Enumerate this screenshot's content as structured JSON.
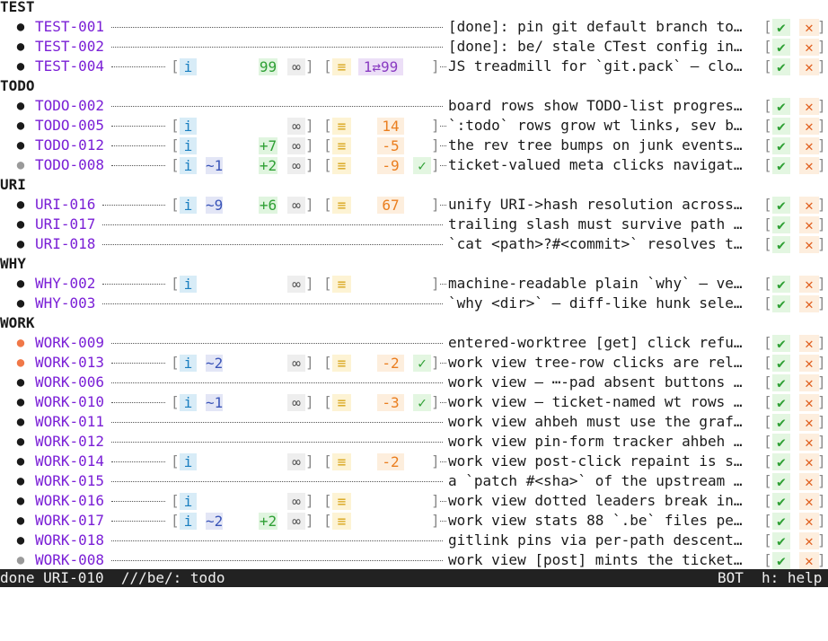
{
  "groups": [
    {
      "title": "TEST",
      "tickets": [
        {
          "id": "TEST-001",
          "dot": "black",
          "desc": "[done]: pin git default branch to…"
        },
        {
          "id": "TEST-002",
          "dot": "black",
          "desc": "[done]: be/ stale CTest config in…"
        },
        {
          "id": "TEST-004",
          "dot": "black",
          "info": "i",
          "plus": "99",
          "inf": "∞",
          "eq": "≡",
          "ahbeh": "1⇄99",
          "desc": "JS treadmill for `git.pack` – clo…"
        }
      ]
    },
    {
      "title": "TODO",
      "tickets": [
        {
          "id": "TODO-002",
          "dot": "black",
          "desc": "board rows show TODO-list progres…"
        },
        {
          "id": "TODO-005",
          "dot": "black",
          "info": "i",
          "inf": "∞",
          "eq": "≡",
          "num": "14",
          "desc": "`:todo` rows grow wt links, sev b…"
        },
        {
          "id": "TODO-012",
          "dot": "black",
          "info": "i",
          "plus": "+7",
          "inf": "∞",
          "eq": "≡",
          "num": "-5",
          "desc": "the rev tree bumps on junk events…"
        },
        {
          "id": "TODO-008",
          "dot": "gray",
          "info": "i",
          "wt": "~1",
          "plus": "+2",
          "inf": "∞",
          "eq": "≡",
          "num": "-9",
          "check": "✓",
          "desc": "ticket-valued meta clicks navigat…"
        }
      ]
    },
    {
      "title": "URI",
      "tickets": [
        {
          "id": "URI-016",
          "dot": "black",
          "info": "i",
          "wt": "~9",
          "plus": "+6",
          "inf": "∞",
          "eq": "≡",
          "num": "67",
          "desc": "unify URI->hash resolution across…"
        },
        {
          "id": "URI-017",
          "dot": "black",
          "desc": "trailing slash must survive path …"
        },
        {
          "id": "URI-018",
          "dot": "black",
          "desc": "`cat <path>?#<commit>` resolves t…"
        }
      ]
    },
    {
      "title": "WHY",
      "tickets": [
        {
          "id": "WHY-002",
          "dot": "black",
          "info": "i",
          "inf": "∞",
          "eq": "≡",
          "desc": "machine-readable plain `why` – ve…"
        },
        {
          "id": "WHY-003",
          "dot": "black",
          "desc": "`why <dir>` – diff-like hunk sele…"
        }
      ]
    },
    {
      "title": "WORK",
      "tickets": [
        {
          "id": "WORK-009",
          "dot": "orange",
          "desc": "entered-worktree [get] click refu…"
        },
        {
          "id": "WORK-013",
          "dot": "orange",
          "info": "i",
          "wt": "~2",
          "inf": "∞",
          "eq": "≡",
          "num": "-2",
          "check": "✓",
          "desc": "work view tree-row clicks are rel…"
        },
        {
          "id": "WORK-006",
          "dot": "black",
          "desc": "work view – ⋯-pad absent buttons …"
        },
        {
          "id": "WORK-010",
          "dot": "black",
          "info": "i",
          "wt": "~1",
          "inf": "∞",
          "eq": "≡",
          "num": "-3",
          "check": "✓",
          "desc": "work view – ticket-named wt rows …"
        },
        {
          "id": "WORK-011",
          "dot": "black",
          "desc": "work view ahbeh must use the graf…"
        },
        {
          "id": "WORK-012",
          "dot": "black",
          "desc": "work view pin-form tracker ahbeh …"
        },
        {
          "id": "WORK-014",
          "dot": "black",
          "info": "i",
          "inf": "∞",
          "eq": "≡",
          "num": "-2",
          "desc": "work view post-click repaint is s…"
        },
        {
          "id": "WORK-015",
          "dot": "black",
          "desc": "a `patch #<sha>` of the upstream …"
        },
        {
          "id": "WORK-016",
          "dot": "black",
          "info": "i",
          "inf": "∞",
          "eq": "≡",
          "desc": "work view dotted leaders break in…"
        },
        {
          "id": "WORK-017",
          "dot": "black",
          "info": "i",
          "wt": "~2",
          "plus": "+2",
          "inf": "∞",
          "eq": "≡",
          "desc": "work view stats 88 `.be` files pe…"
        },
        {
          "id": "WORK-018",
          "dot": "black",
          "desc": "gitlink pins via per-path descent…"
        },
        {
          "id": "WORK-008",
          "dot": "gray",
          "desc": "work view [post] mints the ticket…"
        }
      ]
    }
  ],
  "actions": {
    "done": "✔",
    "drop": "✕",
    "open": "[",
    "close": "]"
  },
  "status": {
    "left": "done URI-010  ///be/: todo",
    "position": "BOT",
    "help": "h: help"
  },
  "colors": {
    "ticket_id": "#7a1fd6",
    "dot_black": "#1a1a1a",
    "dot_gray": "#9a9a9a",
    "dot_orange": "#f07848",
    "status_bg": "#222222"
  }
}
